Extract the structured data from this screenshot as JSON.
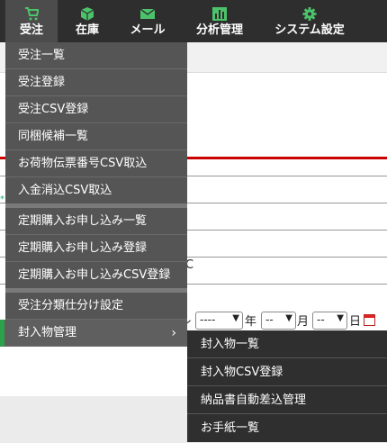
{
  "nav": {
    "items": [
      {
        "label": "受注",
        "icon": "cart-icon"
      },
      {
        "label": "在庫",
        "icon": "box-icon"
      },
      {
        "label": "メール",
        "icon": "mail-icon"
      },
      {
        "label": "分析管理",
        "icon": "chart-icon"
      },
      {
        "label": "システム設定",
        "icon": "gear-icon"
      }
    ]
  },
  "menu": {
    "items": [
      "受注一覧",
      "受注登録",
      "受注CSV登録",
      "同梱候補一覧",
      "お荷物伝票番号CSV取込",
      "入金消込CSV取込",
      "定期購入お申し込み一覧",
      "定期購入お申し込み登録",
      "定期購入お申し込みCSV登録",
      "受注分類仕分け設定",
      "封入物管理"
    ]
  },
  "submenu": {
    "items": [
      "封入物一覧",
      "封入物CSV登録",
      "納品書自動差込管理",
      "お手紙一覧"
    ]
  },
  "background": {
    "fragment_c": "C",
    "fragment_lt": "レ",
    "fragment_star": "*",
    "year_placeholder": "----",
    "year_unit": "年",
    "month_placeholder": "--",
    "month_unit": "月",
    "day_placeholder": "--",
    "day_unit": "日"
  },
  "colors": {
    "nav_bg": "#2e2e2e",
    "nav_icon": "#4cc36a",
    "menu_bg": "#555555",
    "submenu_bg": "#2f2f2f",
    "highlight_bar": "#2aa34a",
    "accent_red": "#cc0000"
  }
}
